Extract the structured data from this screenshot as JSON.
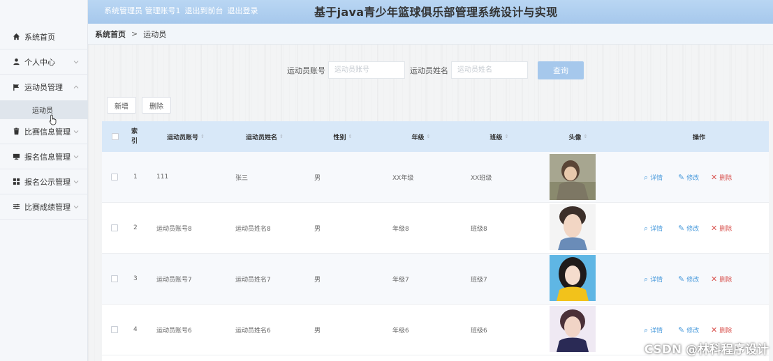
{
  "header": {
    "links": [
      "系统管理员 管理账号1",
      "退出到前台",
      "退出登录"
    ],
    "title": "基于java青少年篮球俱乐部管理系统设计与实现"
  },
  "sidebar": {
    "items": [
      {
        "label": "系统首页",
        "icon": "home-icon"
      },
      {
        "label": "个人中心",
        "icon": "user-icon"
      },
      {
        "label": "运动员管理",
        "icon": "flag-icon"
      },
      {
        "label": "比赛信息管理",
        "icon": "trash-icon"
      },
      {
        "label": "报名信息管理",
        "icon": "monitor-icon"
      },
      {
        "label": "报名公示管理",
        "icon": "grid-icon"
      },
      {
        "label": "比赛成绩管理",
        "icon": "sliders-icon"
      }
    ],
    "sub_item": "运动员"
  },
  "breadcrumb": {
    "home": "系统首页",
    "separator": ">",
    "current": "运动员"
  },
  "search": {
    "account_label": "运动员账号",
    "account_placeholder": "运动员账号",
    "name_label": "运动员姓名",
    "name_placeholder": "运动员姓名",
    "query_button": "查询"
  },
  "toolbar": {
    "add": "新增",
    "delete": "删除"
  },
  "table": {
    "headers": {
      "index": "索引",
      "account": "运动员账号",
      "name": "运动员姓名",
      "gender": "性别",
      "grade": "年级",
      "class": "班级",
      "avatar": "头像",
      "actions": "操作"
    },
    "rows": [
      {
        "index": "1",
        "account": "111",
        "name": "张三",
        "gender": "男",
        "grade": "XX年级",
        "class": "XX班级"
      },
      {
        "index": "2",
        "account": "运动员账号8",
        "name": "运动员姓名8",
        "gender": "男",
        "grade": "年级8",
        "class": "班级8"
      },
      {
        "index": "3",
        "account": "运动员账号7",
        "name": "运动员姓名7",
        "gender": "男",
        "grade": "年级7",
        "class": "班级7"
      },
      {
        "index": "4",
        "account": "运动员账号6",
        "name": "运动员姓名6",
        "gender": "男",
        "grade": "年级6",
        "class": "班级6"
      }
    ],
    "actions": {
      "detail": "详情",
      "edit": "修改",
      "delete": "删除"
    }
  },
  "watermark": "CSDN @林科程序设计",
  "colors": {
    "accent": "#a6c8ec",
    "table_header": "#d8e8f8",
    "link": "#4a9bdc",
    "danger": "#d9534f"
  }
}
